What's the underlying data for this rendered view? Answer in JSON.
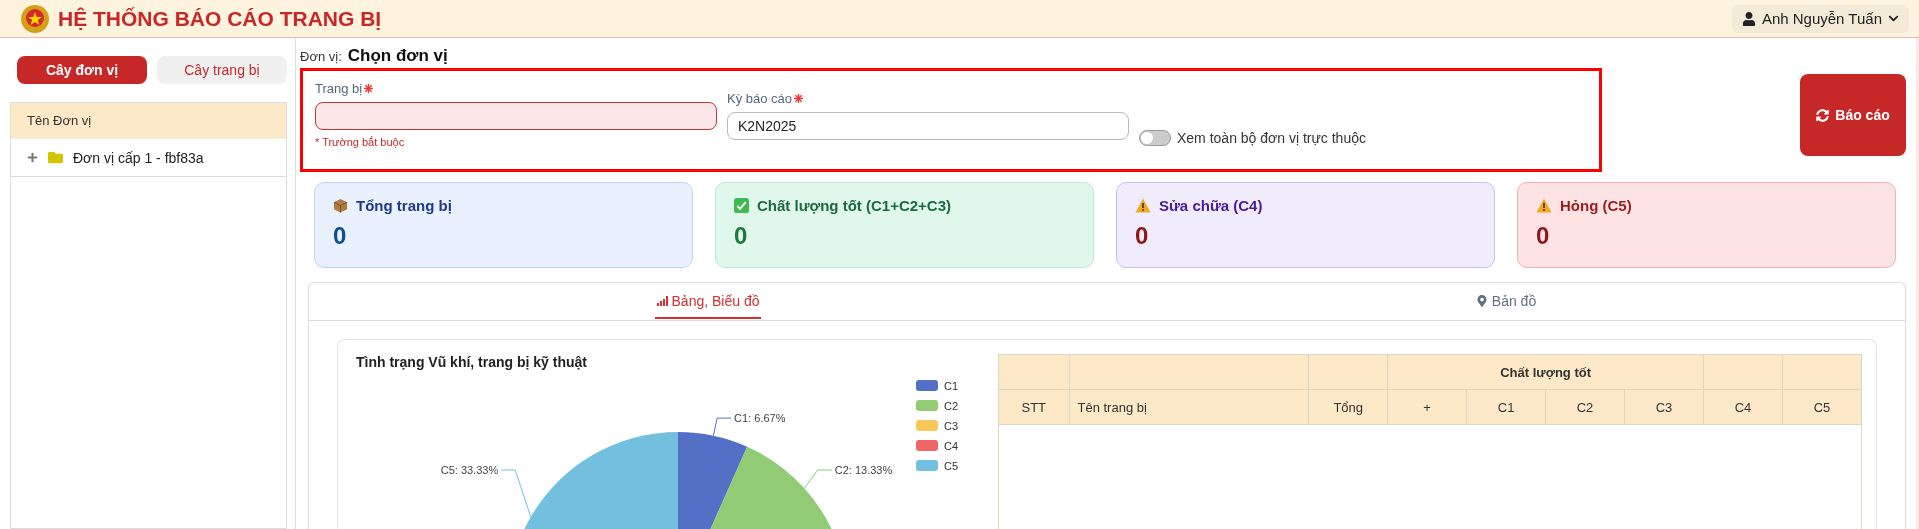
{
  "header": {
    "title": "HỆ THỐNG BÁO CÁO TRANG BỊ",
    "user": "Anh Nguyễn Tuấn"
  },
  "sidebar": {
    "tabs": [
      {
        "label": "Cây đơn vị",
        "selected": true
      },
      {
        "label": "Cây trang bị",
        "selected": false
      }
    ],
    "tree_header": "Tên Đơn vị",
    "tree": [
      {
        "label": "Đơn vị cấp 1 - fbf83a",
        "expanded": false
      }
    ]
  },
  "unit": {
    "label": "Đơn vị:",
    "value": "Chọn đơn vị"
  },
  "filters": {
    "equipment": {
      "label": "Trang bị",
      "error": "* Trường bắt buộc",
      "invalid": true
    },
    "period": {
      "label": "Kỳ báo cáo",
      "value": "K2N2025"
    },
    "toggle": {
      "label": "Xem toàn bộ đơn vị trực thuộc",
      "on": false
    },
    "report_button": "Báo cáo"
  },
  "stats": [
    {
      "kind": "total",
      "label": "Tổng trang bị",
      "value": "0"
    },
    {
      "kind": "good",
      "label": "Chất lượng tốt (C1+C2+C3)",
      "value": "0"
    },
    {
      "kind": "repair",
      "label": "Sửa chữa (C4)",
      "value": "0"
    },
    {
      "kind": "broken",
      "label": "Hỏng (C5)",
      "value": "0"
    }
  ],
  "view_tabs": [
    {
      "kind": "chart",
      "label": "Bảng, Biểu đồ",
      "selected": true
    },
    {
      "kind": "map",
      "label": "Bản đồ",
      "selected": false
    }
  ],
  "chart": {
    "title": "Tình trạng Vũ khí, trang bị kỹ thuật",
    "chart_data": {
      "type": "pie",
      "legend": "right",
      "categories": [
        "C1",
        "C2",
        "C3",
        "C4",
        "C5"
      ],
      "values": [
        6.67,
        13.33,
        null,
        null,
        33.33
      ],
      "colors": [
        "#5470c6",
        "#91cc75",
        "#fac858",
        "#ee6666",
        "#73c0de"
      ],
      "value_labels": [
        "C1: 6.67%",
        "C2: 13.33%",
        null,
        null,
        "C5: 33.33%"
      ]
    }
  },
  "table": {
    "group_header": "Chất lượng tốt",
    "columns": [
      "STT",
      "Tên trang bị",
      "Tổng",
      "+",
      "C1",
      "C2",
      "C3",
      "C4",
      "C5"
    ]
  }
}
